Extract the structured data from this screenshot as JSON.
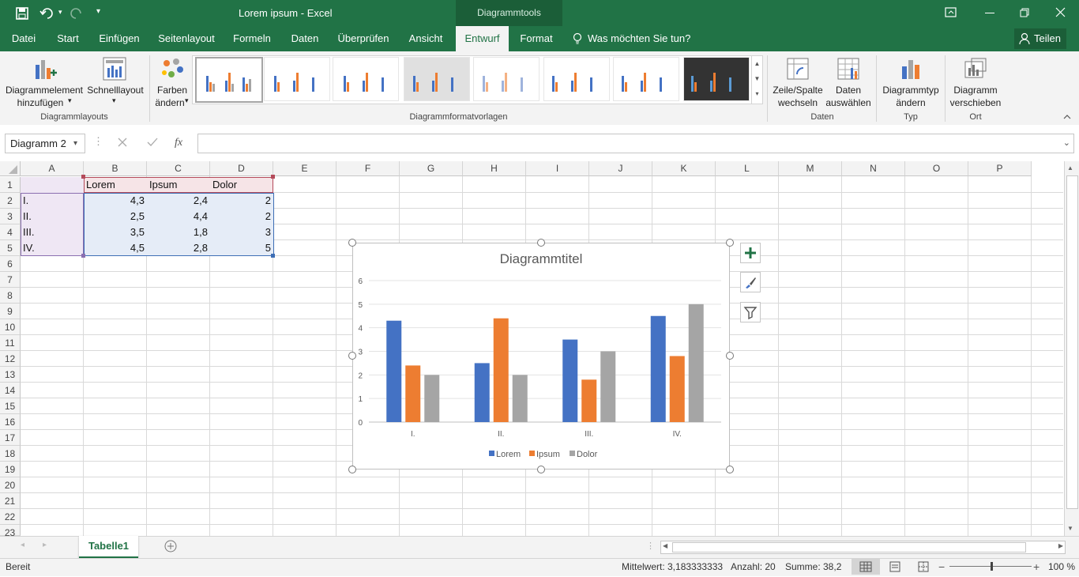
{
  "window": {
    "title": "Lorem ipsum  -  Excel",
    "context_tools": "Diagrammtools",
    "share_label": "Teilen"
  },
  "tabs": [
    {
      "label": "Datei"
    },
    {
      "label": "Start"
    },
    {
      "label": "Einfügen"
    },
    {
      "label": "Seitenlayout"
    },
    {
      "label": "Formeln"
    },
    {
      "label": "Daten"
    },
    {
      "label": "Überprüfen"
    },
    {
      "label": "Ansicht"
    },
    {
      "label": "Entwurf"
    },
    {
      "label": "Format"
    }
  ],
  "tell_me": "Was möchten Sie tun?",
  "ribbon": {
    "add_element": [
      "Diagrammelement",
      "hinzufügen"
    ],
    "quick_layout": "Schnelllayout",
    "change_colors": [
      "Farben",
      "ändern"
    ],
    "group_layouts": "Diagrammlayouts",
    "group_styles": "Diagrammformatvorlagen",
    "switch_row_col": [
      "Zeile/Spalte",
      "wechseln"
    ],
    "select_data": [
      "Daten",
      "auswählen"
    ],
    "group_data": "Daten",
    "change_type": [
      "Diagrammtyp",
      "ändern"
    ],
    "group_type": "Typ",
    "move_chart": [
      "Diagramm",
      "verschieben"
    ],
    "group_location": "Ort"
  },
  "formula": {
    "name_box": "Diagramm 2",
    "fx": "fx"
  },
  "grid": {
    "columns": [
      "A",
      "B",
      "C",
      "D",
      "E",
      "F",
      "G",
      "H",
      "I",
      "J",
      "K",
      "L",
      "M",
      "N",
      "O",
      "P"
    ],
    "rows": [
      "1",
      "2",
      "3",
      "4",
      "5",
      "6",
      "7",
      "8",
      "9",
      "10",
      "11",
      "12",
      "13",
      "14",
      "15",
      "16",
      "17",
      "18",
      "19",
      "20",
      "21",
      "22",
      "23"
    ],
    "headers": [
      "Lorem",
      "Ipsum",
      "Dolor"
    ],
    "data": [
      {
        "label": "I.",
        "b": "4,3",
        "c": "2,4",
        "d": "2"
      },
      {
        "label": "II.",
        "b": "2,5",
        "c": "4,4",
        "d": "2"
      },
      {
        "label": "III.",
        "b": "3,5",
        "c": "1,8",
        "d": "3"
      },
      {
        "label": "IV.",
        "b": "4,5",
        "c": "2,8",
        "d": "5"
      }
    ]
  },
  "chart_data": {
    "type": "bar",
    "title": "Diagrammtitel",
    "categories": [
      "I.",
      "II.",
      "III.",
      "IV."
    ],
    "series": [
      {
        "name": "Lorem",
        "values": [
          4.3,
          2.5,
          3.5,
          4.5
        ],
        "color": "#4472c4"
      },
      {
        "name": "Ipsum",
        "values": [
          2.4,
          4.4,
          1.8,
          2.8
        ],
        "color": "#ed7d31"
      },
      {
        "name": "Dolor",
        "values": [
          2,
          2,
          3,
          5
        ],
        "color": "#a5a5a5"
      }
    ],
    "ylim": [
      0,
      6
    ],
    "yticks": [
      "0",
      "1",
      "2",
      "3",
      "4",
      "5",
      "6"
    ],
    "grid": true,
    "legend": "bottom"
  },
  "sheet": {
    "tab": "Tabelle1"
  },
  "status": {
    "ready": "Bereit",
    "average": "Mittelwert: 3,183333333",
    "count": "Anzahl: 20",
    "sum": "Summe: 38,2",
    "zoom": "100 %"
  },
  "colors": {
    "excel_green": "#217346",
    "accent": "#4472c4"
  }
}
